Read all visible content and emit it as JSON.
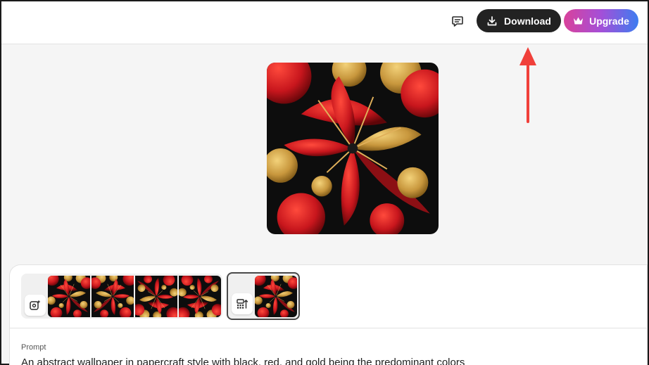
{
  "header": {
    "feedback_icon": "chat-bubble-icon",
    "download_label": "Download",
    "download_icon": "download-icon",
    "upgrade_label": "Upgrade",
    "upgrade_icon": "crown-icon"
  },
  "annotation": {
    "arrow_color": "#f0403a"
  },
  "main_image": {
    "palette": [
      "#0d0d0d",
      "#c8161d",
      "#d4a24a"
    ]
  },
  "variations": {
    "generate_icon": "generate-similar-icon",
    "thumbnail_count": 4
  },
  "reference": {
    "icon": "style-reference-icon"
  },
  "prompt": {
    "label": "Prompt",
    "text": "An abstract wallpaper in papercraft style with black, red, and gold being the predominant colors"
  },
  "colors": {
    "dark_button": "#222222",
    "upgrade_gradient": [
      "#d9429b",
      "#a44fd8",
      "#3d7df0"
    ]
  }
}
